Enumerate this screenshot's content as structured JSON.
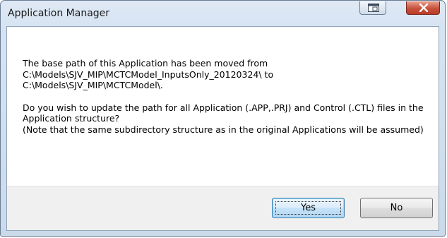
{
  "window": {
    "title": "Application Manager"
  },
  "message": {
    "line1": "The base path of this Application has been moved from",
    "line2": "C:\\Models\\SJV_MIP\\MCTCModel_InputsOnly_20120324\\ to",
    "line3": "C:\\Models\\SJV_MIP\\MCTCModel\\.",
    "question": "Do you wish to update the path for all Application (.APP,.PRJ) and Control (.CTL) files in the Application structure?",
    "note": "(Note that the same subdirectory structure as in the original Applications will be assumed)"
  },
  "buttons": {
    "yes_label": "Yes",
    "no_label": "No"
  },
  "icons": {
    "restore": "restore-window-icon",
    "close": "close-x-icon"
  },
  "colors": {
    "close_button": "#c7513c",
    "focused_button_border": "#3c7fb1"
  }
}
